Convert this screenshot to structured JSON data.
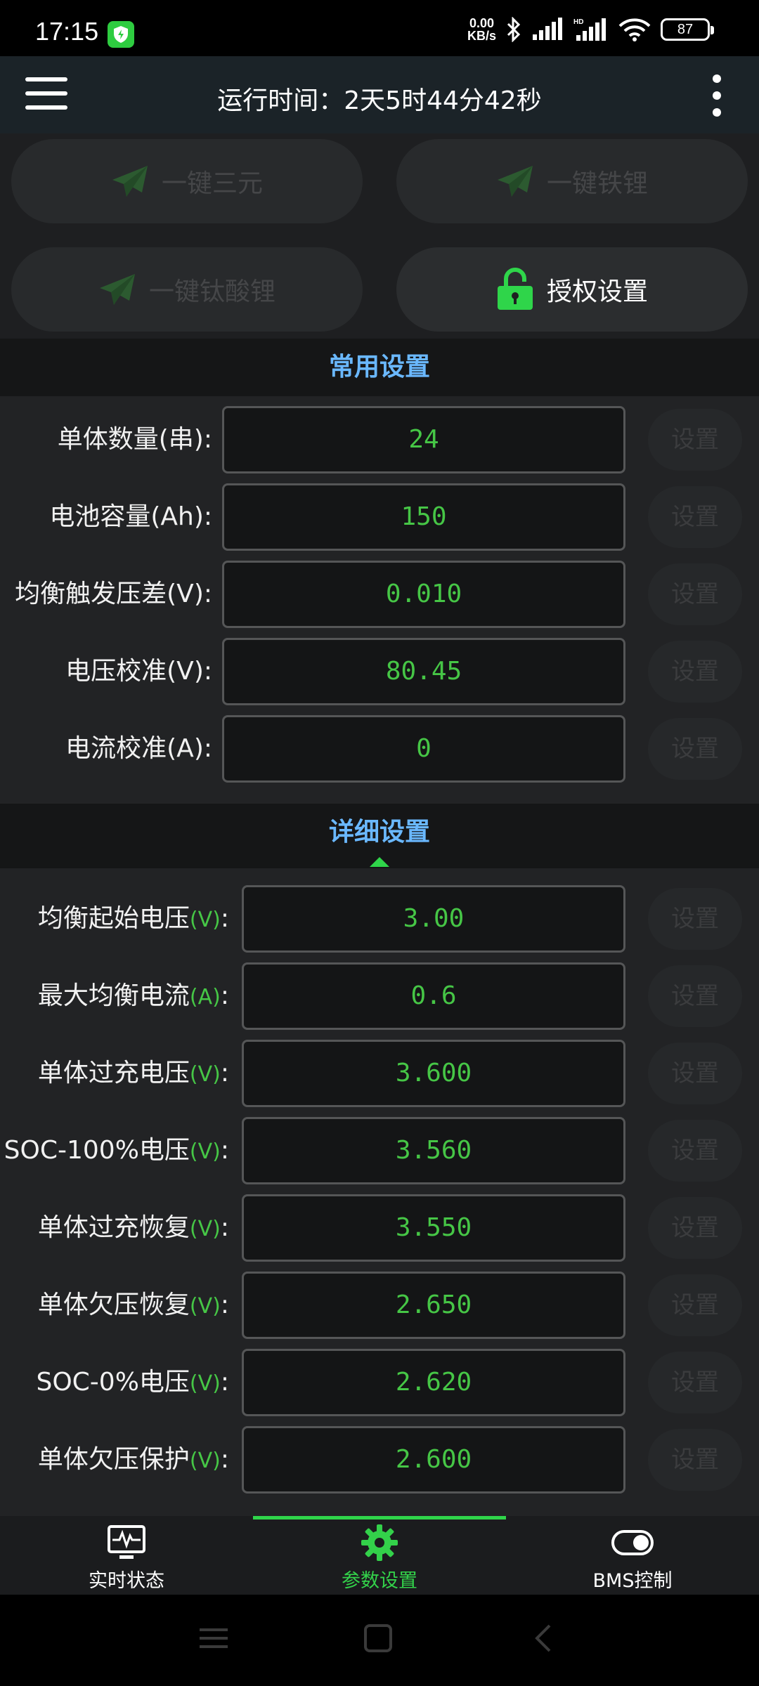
{
  "status_bar": {
    "time": "17:15",
    "net_speed_top": "0.00",
    "net_speed_bottom": "KB/s",
    "battery": "87",
    "icons": [
      "shield-icon",
      "bluetooth-icon",
      "signal-icon",
      "hd-signal-icon",
      "wifi-icon",
      "battery-icon"
    ]
  },
  "header": {
    "runtime": "运行时间：2天5时44分42秒"
  },
  "quick_buttons": [
    {
      "label": "一键三元",
      "enabled": false,
      "icon": "paper-plane-icon"
    },
    {
      "label": "一键铁锂",
      "enabled": false,
      "icon": "paper-plane-icon"
    },
    {
      "label": "一键钛酸锂",
      "enabled": false,
      "icon": "paper-plane-icon"
    },
    {
      "label": "授权设置",
      "enabled": true,
      "icon": "lock-icon"
    }
  ],
  "common_settings": {
    "title": "常用设置",
    "set_label": "设置",
    "rows": [
      {
        "label": "单体数量(串):",
        "value": "24"
      },
      {
        "label": "电池容量(Ah):",
        "value": "150"
      },
      {
        "label": "均衡触发压差(V):",
        "value": "0.010"
      },
      {
        "label": "电压校准(V):",
        "value": "80.45"
      },
      {
        "label": "电流校准(A):",
        "value": "0"
      }
    ]
  },
  "detail_settings": {
    "title": "详细设置",
    "set_label": "设置",
    "rows": [
      {
        "label": "均衡起始电压",
        "unit": "(V)",
        "suffix": ":",
        "value": "3.00"
      },
      {
        "label": "最大均衡电流",
        "unit": "(A)",
        "suffix": ":",
        "value": "0.6"
      },
      {
        "label": "单体过充电压",
        "unit": "(V)",
        "suffix": ":",
        "value": "3.600"
      },
      {
        "label": "SOC-100%电压",
        "unit": "(V)",
        "suffix": ":",
        "value": "3.560"
      },
      {
        "label": "单体过充恢复",
        "unit": "(V)",
        "suffix": ":",
        "value": "3.550"
      },
      {
        "label": "单体欠压恢复",
        "unit": "(V)",
        "suffix": ":",
        "value": "2.650"
      },
      {
        "label": "SOC-0%电压",
        "unit": "(V)",
        "suffix": ":",
        "value": "2.620"
      },
      {
        "label": "单体欠压保护",
        "unit": "(V)",
        "suffix": ":",
        "value": "2.600"
      }
    ]
  },
  "bottom_nav": {
    "items": [
      {
        "label": "实时状态",
        "icon": "monitor-pulse-icon",
        "active": false
      },
      {
        "label": "参数设置",
        "icon": "gear-icon",
        "active": true
      },
      {
        "label": "BMS控制",
        "icon": "toggle-icon",
        "active": false
      }
    ]
  },
  "colors": {
    "accent_green": "#2fd54a",
    "value_green": "#46c646",
    "section_title_blue": "#6ab8ff",
    "header_bg": "#1b2328"
  }
}
